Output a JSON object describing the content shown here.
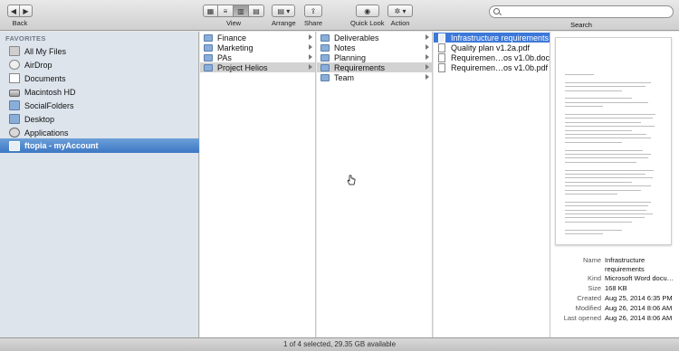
{
  "toolbar": {
    "back_label": "Back",
    "view_label": "View",
    "arrange_label": "Arrange",
    "share_label": "Share",
    "quicklook_label": "Quick Look",
    "action_label": "Action",
    "search_label": "Search",
    "search_value": ""
  },
  "sidebar": {
    "header": "FAVORITES",
    "items": [
      {
        "label": "All My Files",
        "icon": "all-files-icon"
      },
      {
        "label": "AirDrop",
        "icon": "airdrop-icon"
      },
      {
        "label": "Documents",
        "icon": "documents-icon"
      },
      {
        "label": "Macintosh HD",
        "icon": "hard-drive-icon"
      },
      {
        "label": "SocialFolders",
        "icon": "folder-icon"
      },
      {
        "label": "Desktop",
        "icon": "folder-icon"
      },
      {
        "label": "Applications",
        "icon": "applications-icon"
      },
      {
        "label": "ftopia - myAccount",
        "icon": "folder-icon"
      }
    ]
  },
  "columns": {
    "col1": [
      "Finance",
      "Marketing",
      "PAs",
      "Project Helios"
    ],
    "col2": [
      "Deliverables",
      "Notes",
      "Planning",
      "Requirements",
      "Team"
    ],
    "col3": [
      "Infrastructure requirements",
      "Quality plan v1.2a.pdf",
      "Requiremen…os v1.0b.doc",
      "Requiremen…os v1.0b.pdf"
    ]
  },
  "info": {
    "name_key": "Name",
    "name_val": "Infrastructure requirements",
    "kind_key": "Kind",
    "kind_val": "Microsoft Word docu…",
    "size_key": "Size",
    "size_val": "168 KB",
    "created_key": "Created",
    "created_val": "Aug 25, 2014 6:35 PM",
    "modified_key": "Modified",
    "modified_val": "Aug 26, 2014 8:06 AM",
    "opened_key": "Last opened",
    "opened_val": "Aug 26, 2014 8:06 AM"
  },
  "status": "1 of 4 selected, 29.35 GB available",
  "colors": {
    "selection": "#3d78d8",
    "sidebar_bg": "#dde4ec",
    "highlight": "#d2d2d2"
  }
}
